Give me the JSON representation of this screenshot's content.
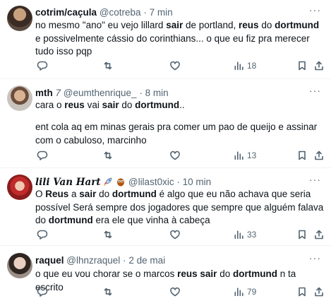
{
  "tweets": [
    {
      "name": "cotrim/caçula",
      "handle": "@cotreba",
      "sep": "·",
      "time": "7 min",
      "body": [
        {
          "t": "no mesmo \"ano\" eu vejo lillard "
        },
        {
          "t": "sair",
          "b": true
        },
        {
          "t": " de portland, "
        },
        {
          "t": "reus",
          "b": true
        },
        {
          "t": " do "
        },
        {
          "t": "dortmund",
          "b": true
        },
        {
          "t": " e possivelmente cássio do corinthians... o que eu fiz pra merecer tudo isso pqp"
        }
      ],
      "views": "18"
    },
    {
      "name": "mth",
      "name_suffix": "7",
      "handle": "@eumthenrique_",
      "sep": "·",
      "time": "8 min",
      "body_lines": [
        [
          {
            "t": "cara       o "
          },
          {
            "t": "reus",
            "b": true
          },
          {
            "t": " vai "
          },
          {
            "t": "sair",
            "b": true
          },
          {
            "t": " do "
          },
          {
            "t": "dortmund",
            "b": true
          },
          {
            "t": ".."
          }
        ],
        [
          {
            "t": "ent cola aq em minas gerais pra comer um pao de queijo e assinar com o cabuloso, marcinho"
          }
        ]
      ],
      "views": "13"
    },
    {
      "name": "lili Van Hart",
      "name_emojis": [
        "rocket",
        "owl"
      ],
      "handle": "@lilast0xic",
      "sep": "·",
      "time": "10 min",
      "body": [
        {
          "t": "O "
        },
        {
          "t": "Reus",
          "b": true
        },
        {
          "t": " a "
        },
        {
          "t": "sair",
          "b": true
        },
        {
          "t": " do "
        },
        {
          "t": "dortmund",
          "b": true
        },
        {
          "t": " é algo que eu não achava que seria possível Será sempre dos jogadores que sempre que alguém falava do "
        },
        {
          "t": "dortmund",
          "b": true
        },
        {
          "t": " era ele que vinha à cabeça"
        }
      ],
      "views": "33"
    },
    {
      "name": "raquel",
      "handle": "@lhnzraquel",
      "sep": "·",
      "time": "2 de mai",
      "body": [
        {
          "t": "o que eu vou chorar se o marcos "
        },
        {
          "t": "reus",
          "b": true
        },
        {
          "t": " "
        },
        {
          "t": "sair",
          "b": true
        },
        {
          "t": " do "
        },
        {
          "t": "dortmund",
          "b": true
        },
        {
          "t": " n ta escrito"
        }
      ],
      "views": "79"
    }
  ],
  "icons": {
    "reply": "reply-icon",
    "retweet": "retweet-icon",
    "like": "like-icon",
    "views": "views-icon",
    "bookmark": "bookmark-icon",
    "share": "share-icon",
    "more": "more-icon"
  },
  "colors": {
    "text": "#0f1419",
    "secondary": "#536471",
    "divider": "#eff3f4"
  }
}
